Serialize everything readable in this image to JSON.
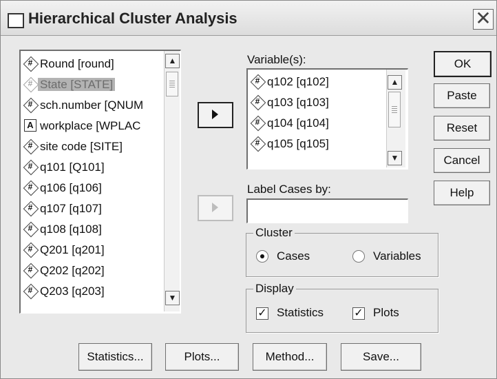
{
  "window": {
    "title": "Hierarchical Cluster Analysis",
    "close_glyph": "✕"
  },
  "source_list": {
    "items": [
      {
        "label": "Round [round]",
        "type": "numeric",
        "selected": false
      },
      {
        "label": "State [STATE]",
        "type": "numeric",
        "selected": true
      },
      {
        "label": "sch.number [QNUM",
        "type": "numeric",
        "selected": false
      },
      {
        "label": "workplace [WPLAC",
        "type": "string",
        "selected": false
      },
      {
        "label": "site code [SITE]",
        "type": "numeric",
        "selected": false
      },
      {
        "label": "q101 [Q101]",
        "type": "numeric",
        "selected": false
      },
      {
        "label": "q106 [q106]",
        "type": "numeric",
        "selected": false
      },
      {
        "label": "q107 [q107]",
        "type": "numeric",
        "selected": false
      },
      {
        "label": "q108 [q108]",
        "type": "numeric",
        "selected": false
      },
      {
        "label": "Q201 [q201]",
        "type": "numeric",
        "selected": false
      },
      {
        "label": "Q202 [q202]",
        "type": "numeric",
        "selected": false
      },
      {
        "label": "Q203 [q203]",
        "type": "numeric",
        "selected": false
      }
    ]
  },
  "variables": {
    "label": "Variable(s):",
    "items": [
      {
        "label": "q102 [q102]"
      },
      {
        "label": "q103 [q103]"
      },
      {
        "label": "q104 [q104]"
      },
      {
        "label": "q105 [q105]"
      }
    ]
  },
  "label_cases": {
    "label": "Label Cases by:",
    "value": ""
  },
  "cluster_group": {
    "title": "Cluster",
    "options": [
      {
        "label": "Cases",
        "selected": true
      },
      {
        "label": "Variables",
        "selected": false
      }
    ]
  },
  "display_group": {
    "title": "Display",
    "options": [
      {
        "label": "Statistics",
        "checked": true
      },
      {
        "label": "Plots",
        "checked": true
      }
    ]
  },
  "side_buttons": {
    "ok": "OK",
    "paste": "Paste",
    "reset": "Reset",
    "cancel": "Cancel",
    "help": "Help"
  },
  "bottom_buttons": {
    "statistics": "Statistics...",
    "plots": "Plots...",
    "method": "Method...",
    "save": "Save..."
  },
  "icons": {
    "numeric_variable": "numeric-variable-icon",
    "string_variable": "string-variable-icon",
    "check_glyph": "✓",
    "numeric_glyph": "#",
    "string_glyph": "A"
  }
}
